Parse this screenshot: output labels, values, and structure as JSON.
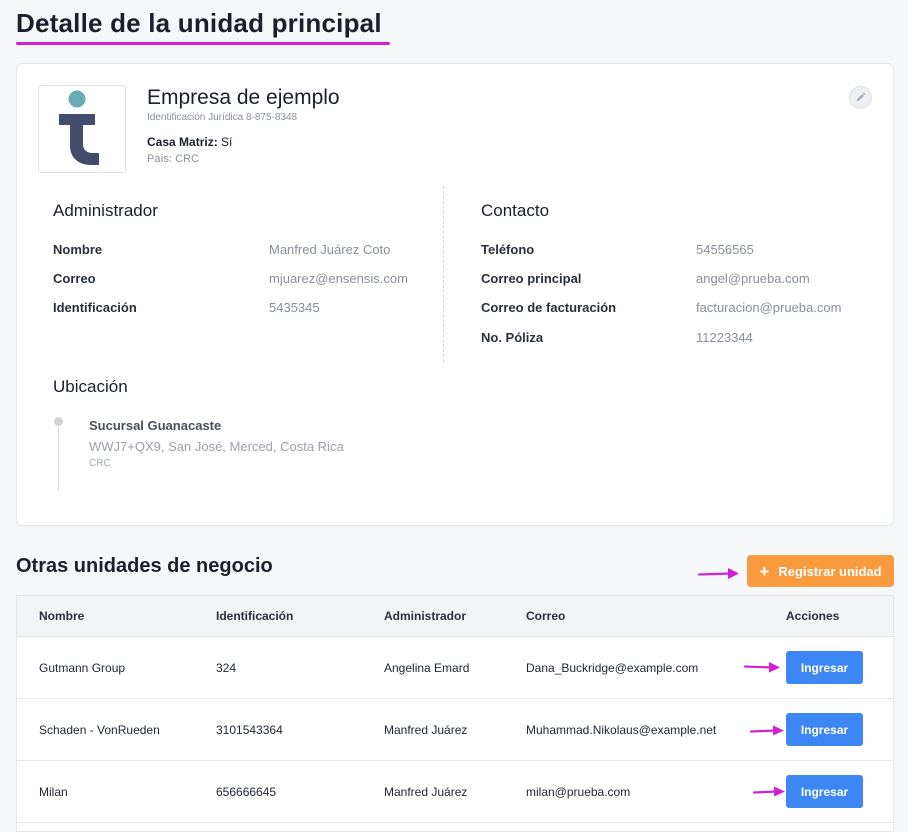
{
  "page": {
    "title": "Detalle de la unidad principal"
  },
  "company": {
    "name": "Empresa de ejemplo",
    "identification": "Identificación Jurídica 8-875-8348",
    "casa_matriz_label": "Casa Matriz:",
    "casa_matriz_value": "Sí",
    "country": "País: CRC"
  },
  "administrator": {
    "title": "Administrador",
    "rows": [
      {
        "label": "Nombre",
        "value": "Manfred Juárez Coto"
      },
      {
        "label": "Correo",
        "value": "mjuarez@ensensis.com"
      },
      {
        "label": "Identificación",
        "value": "5435345"
      }
    ]
  },
  "contact": {
    "title": "Contacto",
    "rows": [
      {
        "label": "Teléfono",
        "value": "54556565"
      },
      {
        "label": "Correo principal",
        "value": "angel@prueba.com"
      },
      {
        "label": "Correo de facturación",
        "value": "facturacion@prueba.com"
      },
      {
        "label": "No. Póliza",
        "value": "11223344"
      }
    ]
  },
  "location": {
    "title": "Ubicación",
    "branch_name": "Sucursal Guanacaste",
    "address": "WWJ7+QX9, San José, Merced, Costa Rica",
    "country": "CRC"
  },
  "other_units": {
    "title": "Otras unidades de negocio",
    "register_label": "Registrar unidad",
    "columns": [
      "Nombre",
      "Identificación",
      "Administrador",
      "Correo",
      "Acciones"
    ],
    "rows": [
      {
        "name": "Gutmann Group",
        "id": "324",
        "admin": "Angelina Emard",
        "email": "Dana_Buckridge@example.com",
        "action": "Ingresar"
      },
      {
        "name": "Schaden - VonRueden",
        "id": "3101543364",
        "admin": "Manfred Juárez",
        "email": "Muhammad.Nikolaus@example.net",
        "action": "Ingresar"
      },
      {
        "name": "Milan",
        "id": "656666645",
        "admin": "Manfred Juárez",
        "email": "milan@prueba.com",
        "action": "Ingresar"
      }
    ]
  },
  "colors": {
    "accent_magenta": "#d320d8",
    "register_orange": "#f99a3e",
    "ingresar_blue": "#3d87f5",
    "logo_teal": "#6aacb5",
    "logo_navy": "#454b6b"
  },
  "icons": {
    "edit": "pencil-icon",
    "register": "plus-icon",
    "annotation": "arrow-right-icon"
  }
}
